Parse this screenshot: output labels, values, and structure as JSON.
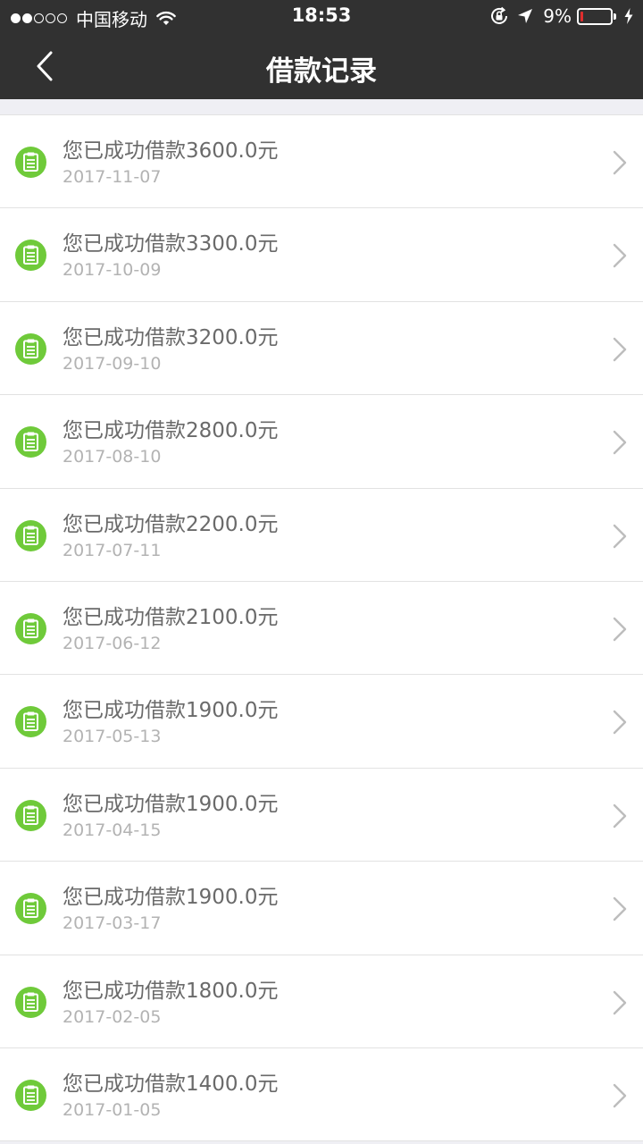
{
  "status_bar": {
    "carrier": "中国移动",
    "time": "18:53",
    "battery_percent": "9%",
    "battery_level": 0.09,
    "signal_strength": 2,
    "signal_total": 5
  },
  "header": {
    "title": "借款记录"
  },
  "colors": {
    "header_bg": "#313131",
    "icon_green": "#6fca3a",
    "battery_low": "#e02d2d"
  },
  "records": [
    {
      "title": "您已成功借款3600.0元",
      "date": "2017-11-07"
    },
    {
      "title": "您已成功借款3300.0元",
      "date": "2017-10-09"
    },
    {
      "title": "您已成功借款3200.0元",
      "date": "2017-09-10"
    },
    {
      "title": "您已成功借款2800.0元",
      "date": "2017-08-10"
    },
    {
      "title": "您已成功借款2200.0元",
      "date": "2017-07-11"
    },
    {
      "title": "您已成功借款2100.0元",
      "date": "2017-06-12"
    },
    {
      "title": "您已成功借款1900.0元",
      "date": "2017-05-13"
    },
    {
      "title": "您已成功借款1900.0元",
      "date": "2017-04-15"
    },
    {
      "title": "您已成功借款1900.0元",
      "date": "2017-03-17"
    },
    {
      "title": "您已成功借款1800.0元",
      "date": "2017-02-05"
    },
    {
      "title": "您已成功借款1400.0元",
      "date": "2017-01-05"
    }
  ]
}
